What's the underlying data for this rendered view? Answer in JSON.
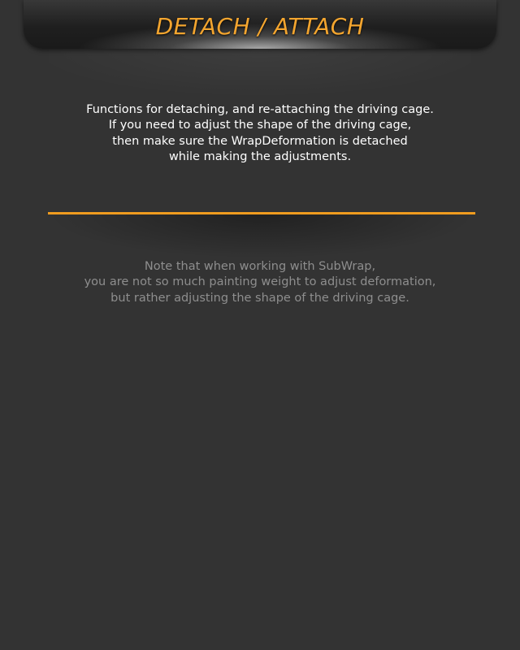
{
  "header": {
    "title": "DETACH / ATTACH"
  },
  "description": {
    "lines": [
      "Functions for detaching, and re-attaching the driving cage.",
      "If you need to adjust the shape of the driving cage,",
      "then make sure the WrapDeformation is detached",
      "while making the adjustments."
    ]
  },
  "note": {
    "lines": [
      "Note that when working with SubWrap,",
      "you are not so much painting weight to adjust deformation,",
      "but rather adjusting the shape of the driving cage."
    ]
  },
  "colors": {
    "background": "#333333",
    "accent": "#f09c1f",
    "title_text": "#f3a52f",
    "description_text": "#ffffff",
    "note_text": "#8e8e8e"
  }
}
